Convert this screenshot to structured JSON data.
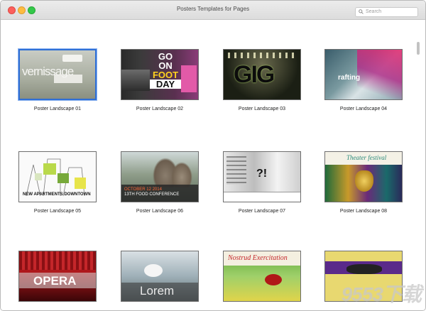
{
  "window": {
    "title": "Posters Templates for Pages"
  },
  "search": {
    "placeholder": "Search"
  },
  "templates": [
    {
      "caption": "Poster Landscape 01",
      "overlay": "vernissage"
    },
    {
      "caption": "Poster Landscape 02",
      "overlay_lines": [
        "GO",
        "ON",
        "FOOT",
        "DAY"
      ]
    },
    {
      "caption": "Poster Landscape 03",
      "overlay": "GIG"
    },
    {
      "caption": "Poster Landscape 04",
      "overlay": "rafting"
    },
    {
      "caption": "Poster Landscape 05",
      "overlay": "NEW APARTMENTS DOWNTOWN"
    },
    {
      "caption": "Poster Landscape 06",
      "overlay_lines": [
        "OCTOBER 12 2014",
        "13TH FOOD CONFERENCE"
      ]
    },
    {
      "caption": "Poster Landscape 07",
      "overlay": "?!"
    },
    {
      "caption": "Poster Landscape 08",
      "overlay": "Theater festival"
    },
    {
      "caption": "",
      "overlay": "OPERA"
    },
    {
      "caption": "",
      "overlay": "Lorem"
    },
    {
      "caption": "",
      "overlay": "Nostrud Exercitation"
    },
    {
      "caption": "",
      "overlay": ""
    }
  ],
  "watermark": "9553下载",
  "colors": {
    "selection": "#2f6fd6",
    "close": "#fc605c",
    "minimize": "#fdbc40",
    "maximize": "#34c84a"
  }
}
